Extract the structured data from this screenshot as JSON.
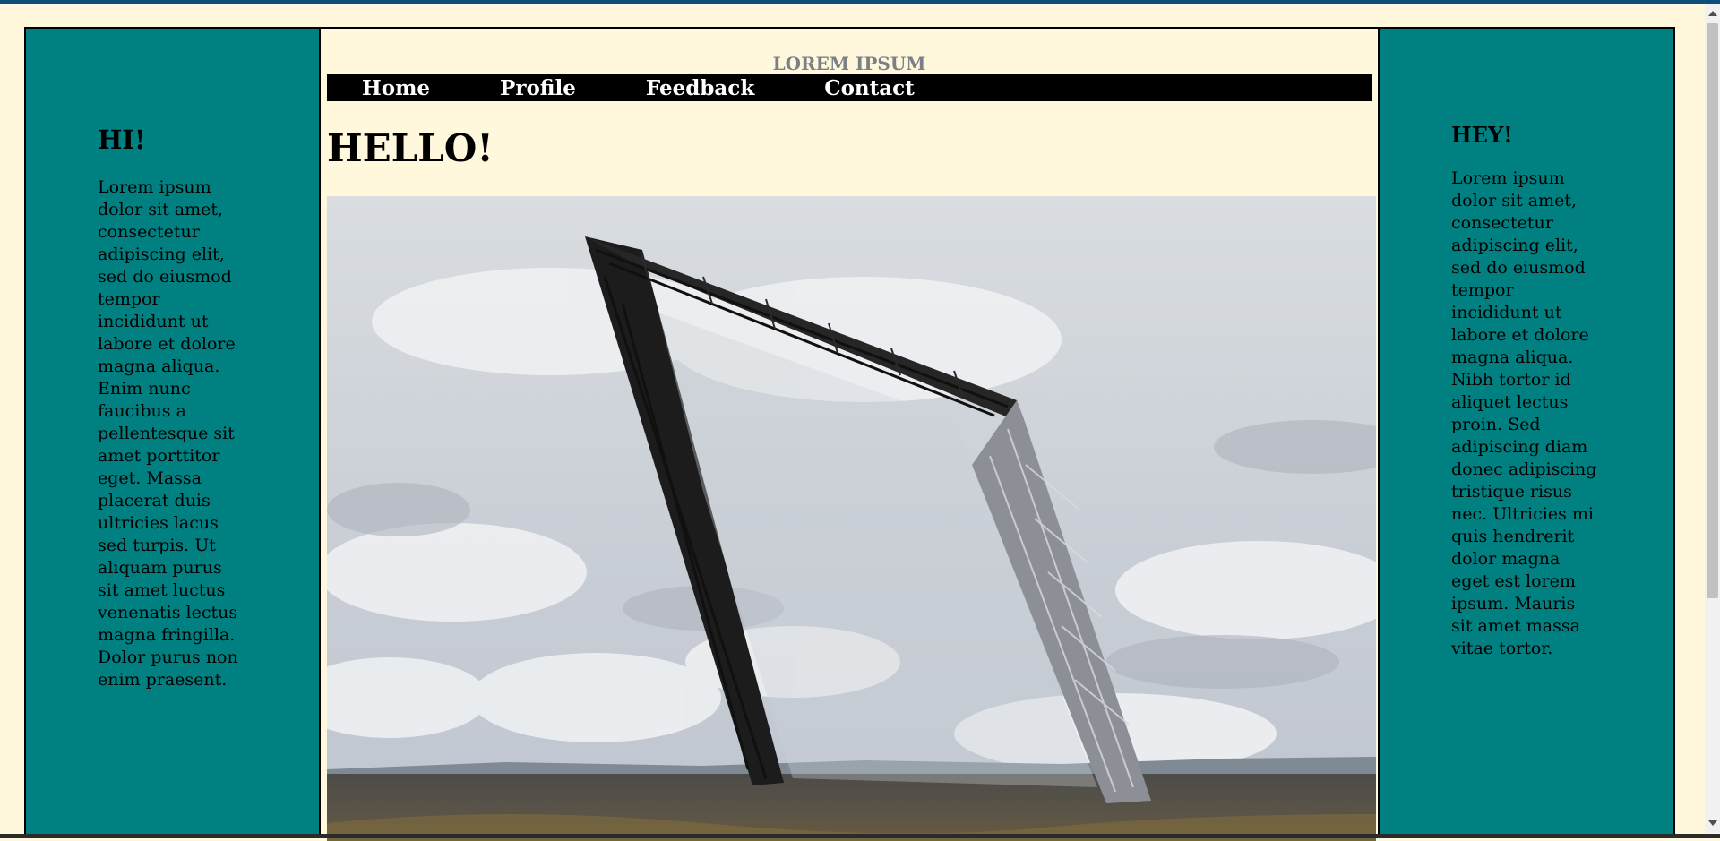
{
  "header": {
    "site_title": "LOREM IPSUM"
  },
  "nav": {
    "items": [
      "Home",
      "Profile",
      "Feedback",
      "Contact"
    ]
  },
  "main": {
    "heading": "HELLO!",
    "image_alt": "Steel frame landmark sculpture under cloudy sky"
  },
  "left_sidebar": {
    "heading": "HI!",
    "text": "Lorem ipsum dolor sit amet, consectetur adipiscing elit, sed do eiusmod tempor incididunt ut labore et dolore magna aliqua. Enim nunc faucibus a pellentesque sit amet porttitor eget. Massa placerat duis ultricies lacus sed turpis. Ut aliquam purus sit amet luctus venenatis lectus magna fringilla. Dolor purus non enim praesent."
  },
  "right_sidebar": {
    "heading": "HEY!",
    "text": "Lorem ipsum dolor sit amet, consectetur adipiscing elit, sed do eiusmod tempor incididunt ut labore et dolore magna aliqua. Nibh tortor id aliquet lectus proin. Sed adipiscing diam donec adipiscing tristique risus nec. Ultricies mi quis hendrerit dolor magna eget est lorem ipsum. Mauris sit amet massa vitae tortor."
  },
  "colors": {
    "page_background": "#fff8dc",
    "sidebar_background": "#008080",
    "nav_background": "#000000",
    "title_color": "#7b7f86"
  }
}
